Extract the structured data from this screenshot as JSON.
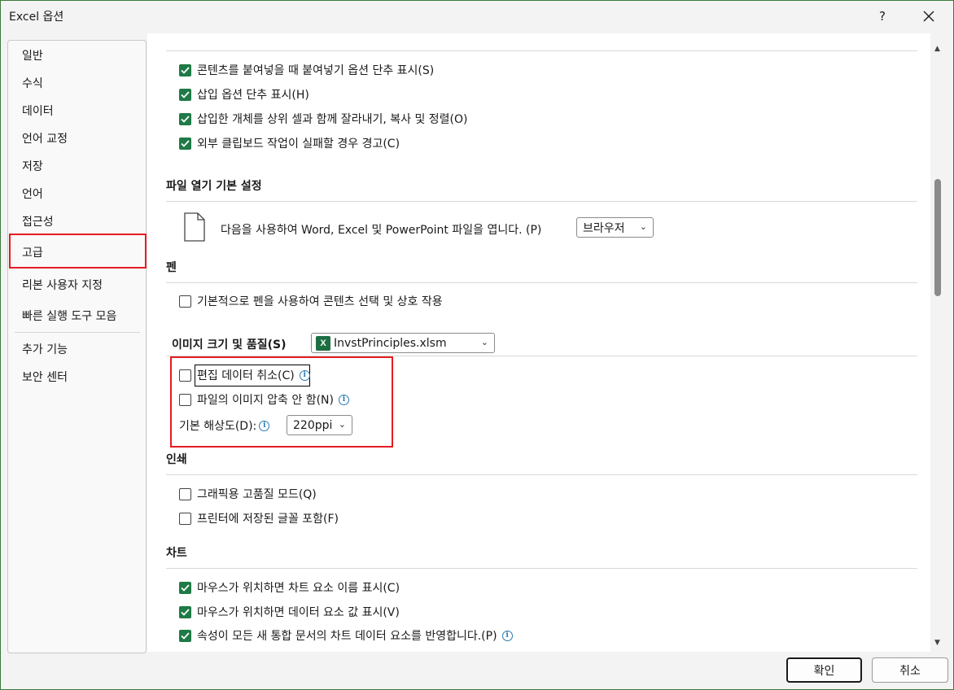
{
  "window": {
    "title": "Excel 옵션",
    "help": "?",
    "close": "✕"
  },
  "sidebar": {
    "items": [
      {
        "label": "일반"
      },
      {
        "label": "수식"
      },
      {
        "label": "데이터"
      },
      {
        "label": "언어 교정"
      },
      {
        "label": "저장"
      },
      {
        "label": "언어"
      },
      {
        "label": "접근성"
      },
      {
        "label": "고급"
      },
      {
        "label": "리본 사용자 지정"
      },
      {
        "label": "빠른 실행 도구 모음"
      },
      {
        "label": "추가 기능"
      },
      {
        "label": "보안 센터"
      }
    ],
    "selected": "고급"
  },
  "paste": {
    "items": [
      {
        "label": "콘텐츠를 붙여넣을 때 붙여넣기 옵션 단추 표시(S)",
        "checked": true
      },
      {
        "label": "삽입 옵션 단추 표시(H)",
        "checked": true
      },
      {
        "label": "삽입한 개체를 상위 셀과 함께 잘라내기, 복사 및 정렬(O)",
        "checked": true
      },
      {
        "label": "외부 클립보드 작업이 실패할 경우 경고(C)",
        "checked": true
      }
    ]
  },
  "file_open": {
    "title": "파일 열기 기본 설정",
    "text": "다음을 사용하여 Word, Excel 및 PowerPoint 파일을 엽니다. (P)",
    "dropdown": "브라우저"
  },
  "pen": {
    "title": "펜",
    "item": {
      "label": "기본적으로 펜을 사용하여 콘텐츠 선택 및 상호 작용",
      "checked": false
    }
  },
  "image": {
    "title": "이미지 크기 및 품질(S)",
    "file_dropdown": "InvstPrinciples.xlsm",
    "file_icon": "X",
    "discard": {
      "label": "편집 데이터 취소(C)",
      "checked": false
    },
    "nocompress": {
      "label": "파일의 이미지 압축 안 함(N)",
      "checked": false
    },
    "resolution_label": "기본 해상도(D):",
    "resolution": "220ppi"
  },
  "print": {
    "title": "인쇄",
    "items": [
      {
        "label": "그래픽용 고품질 모드(Q)",
        "checked": false
      },
      {
        "label": "프린터에 저장된 글꼴 포함(F)",
        "checked": false
      }
    ]
  },
  "chart": {
    "title": "차트",
    "items": [
      {
        "label": "마우스가 위치하면 차트 요소 이름 표시(C)",
        "checked": true
      },
      {
        "label": "마우스가 위치하면 데이터 요소 값 표시(V)",
        "checked": true
      },
      {
        "label": "속성이 모든 새 통합 문서의 차트 데이터 요소를 반영합니다.(P)",
        "checked": true
      }
    ]
  },
  "buttons": {
    "ok": "확인",
    "cancel": "취소"
  },
  "icons": {
    "info": "i",
    "chevron": "⌄",
    "scroll_up": "▲",
    "scroll_down": "▼"
  },
  "colors": {
    "accent": "#1e7a46",
    "highlight": "#e51c23"
  }
}
